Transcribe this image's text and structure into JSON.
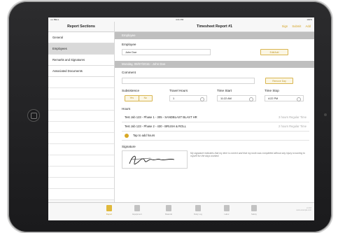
{
  "status": {
    "carrier": "•••• BELL",
    "time": "4:21 PM",
    "battery": "100%"
  },
  "sidebar": {
    "title": "Report Sections",
    "items": [
      {
        "label": "General",
        "selected": false
      },
      {
        "label": "Employees",
        "selected": true
      },
      {
        "label": "Remarks and Signatures",
        "selected": false
      },
      {
        "label": "Associated Documents",
        "selected": false
      }
    ]
  },
  "main": {
    "title": "Timesheet Report #1",
    "actions": {
      "sign": "Sign",
      "submit": "Submit",
      "add": "Add"
    },
    "employee_section": "Employee",
    "employee_label": "Employee",
    "employee_value": "John Doe",
    "edit_button": "Edit/Add",
    "day_section": "Monday, 09/07/2015 - John Doe",
    "comment_label": "Comment",
    "comment_value": "",
    "remove_button": "Remove Day",
    "subsistence_label": "Subsistence",
    "subsistence_options": [
      "Yes",
      "No"
    ],
    "travel_label": "Travel Hours",
    "travel_value": "1",
    "start_label": "Time Start",
    "start_value": "11:22 AM",
    "stop_label": "Time Stop",
    "stop_value": "4:22 PM",
    "hours_label": "Hours",
    "hours": [
      {
        "desc": "Test Job 123 - Phase 1 - 305 - SANDBLAST BLAST HR",
        "amount": "3 hours Regular Time"
      },
      {
        "desc": "Test Job 123 - Phase 2 - 430 - BRUSH & ROLL",
        "amount": "2 hours Regular Time"
      }
    ],
    "add_hours": "Tap to add hours",
    "signature_label": "Signature",
    "signature_note": "My signature indicates that my time is correct and that my work was completed without any injury occurring to myself for the days worked."
  },
  "tabbar": {
    "tabs": [
      {
        "label": "Report",
        "icon": "report-icon",
        "active": true
      },
      {
        "label": "Equipment",
        "icon": "equipment-icon",
        "active": false
      },
      {
        "label": "Material",
        "icon": "material-icon",
        "active": false
      },
      {
        "label": "Daily Log",
        "icon": "daily-log-icon",
        "active": false
      },
      {
        "label": "Labor",
        "icon": "labor-icon",
        "active": false
      },
      {
        "label": "Safety",
        "icon": "safety-icon",
        "active": false
      }
    ],
    "footer_text": [
      "v1.9.0",
      "www.example.com"
    ]
  },
  "colors": {
    "accent": "#d8a825",
    "section_header": "#bfbfbf"
  }
}
